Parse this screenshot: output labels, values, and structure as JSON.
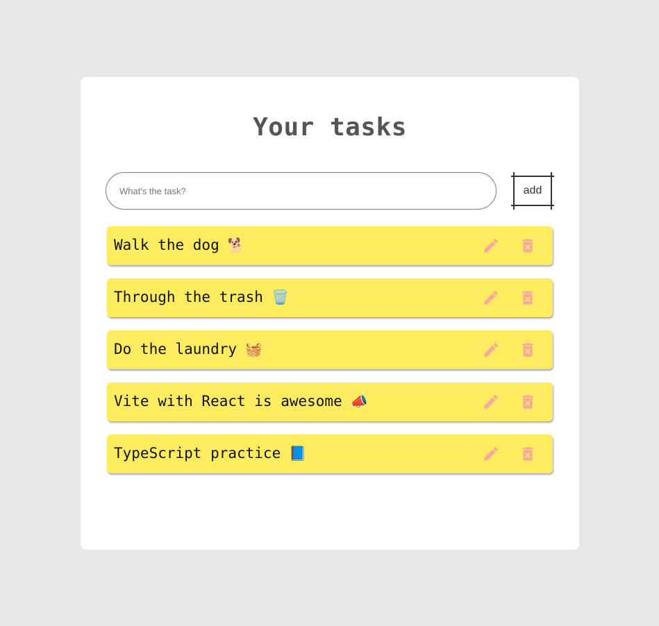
{
  "header": {
    "title": "Your tasks"
  },
  "form": {
    "placeholder": "What's the task?",
    "value": "",
    "add_label": "add"
  },
  "tasks": [
    {
      "text": "Walk the dog",
      "emoji": "🐕"
    },
    {
      "text": "Through the trash",
      "emoji": "🗑️"
    },
    {
      "text": "Do the laundry",
      "emoji": "🧺"
    },
    {
      "text": "Vite with React is awesome",
      "emoji": "📣"
    },
    {
      "text": "TypeScript practice",
      "emoji": "📘"
    }
  ],
  "icons": {
    "edit": "pencil-icon",
    "delete": "trash-icon"
  },
  "colors": {
    "background": "#e8e8e8",
    "card": "#ffffff",
    "task_background": "#fdec5f",
    "icon": "#f9a8a0",
    "title": "#555555"
  }
}
